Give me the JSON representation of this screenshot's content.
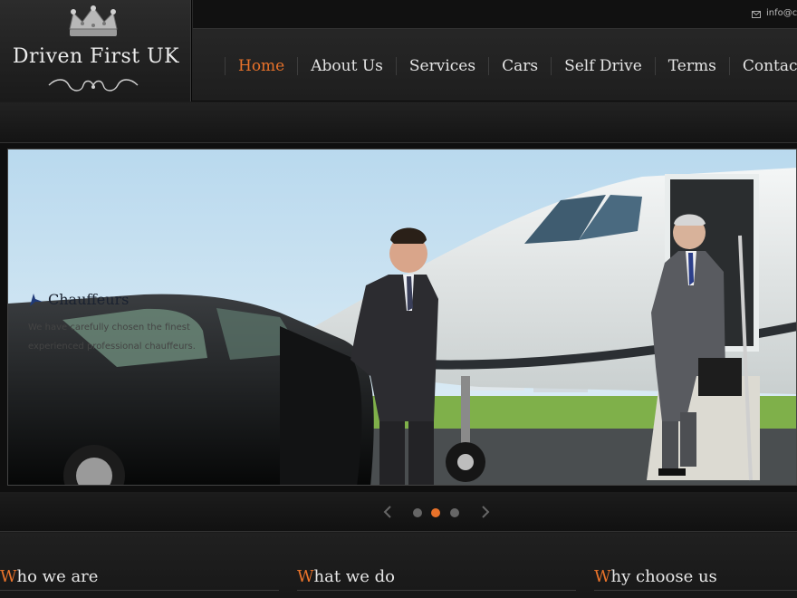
{
  "brand": {
    "name": "Driven First UK"
  },
  "contact": {
    "email_partial": "info@c"
  },
  "nav": {
    "items": [
      {
        "label": "Home",
        "active": true
      },
      {
        "label": "About Us"
      },
      {
        "label": "Services"
      },
      {
        "label": "Cars"
      },
      {
        "label": "Self Drive"
      },
      {
        "label": "Terms"
      },
      {
        "label": "Contact"
      }
    ]
  },
  "slider": {
    "caption_title": "Chauffeurs",
    "caption_text": "We have carefully chosen the finest experienced professional chauffeurs.",
    "current_slide": 2,
    "total_slides": 3
  },
  "sections": [
    {
      "first": "W",
      "rest": "ho we are"
    },
    {
      "first": "W",
      "rest": "hat we do"
    },
    {
      "first": "W",
      "rest": "hy choose us"
    }
  ],
  "colors": {
    "accent": "#e8722a",
    "background": "#1b1b1b",
    "text": "#e4e4e4"
  }
}
